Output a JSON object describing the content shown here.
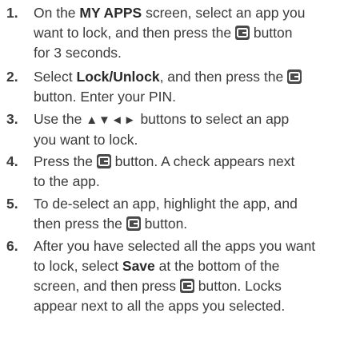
{
  "steps": [
    {
      "number": "1.",
      "lines": [
        [
          "On the ",
          {
            "b": "MY APPS"
          },
          " screen, select an app you"
        ],
        [
          "want to lock, and then press the ",
          {
            "icon": "enter-icon"
          },
          " button"
        ],
        [
          "for 3 seconds."
        ]
      ]
    },
    {
      "number": "2.",
      "lines": [
        [
          "Select ",
          {
            "b": "Lock/Unlock"
          },
          ", and then press the ",
          {
            "icon": "enter-icon"
          }
        ],
        [
          "button. Enter your PIN."
        ]
      ]
    },
    {
      "number": "3.",
      "lines": [
        [
          "Use the ",
          {
            "arrows": "▲▼◄►"
          },
          " buttons to select an app"
        ],
        [
          "you want to lock."
        ]
      ]
    },
    {
      "number": "4.",
      "lines": [
        [
          "Press the ",
          {
            "icon": "enter-icon"
          },
          " button. A check appears next"
        ],
        [
          "to the app."
        ]
      ]
    },
    {
      "number": "5.",
      "lines": [
        [
          "To de-select an app, highlight the app, and"
        ],
        [
          "then press the ",
          {
            "icon": "enter-icon"
          },
          " button."
        ]
      ]
    },
    {
      "number": "6.",
      "lines": [
        [
          "After you have selected all the apps you want"
        ],
        [
          "to lock, select ",
          {
            "b": "Save"
          },
          " at the bottom of the"
        ],
        [
          "screen, and then press ",
          {
            "icon": "enter-icon"
          },
          " button. Locks"
        ],
        [
          "appear next to all the apps you selected."
        ]
      ]
    }
  ]
}
